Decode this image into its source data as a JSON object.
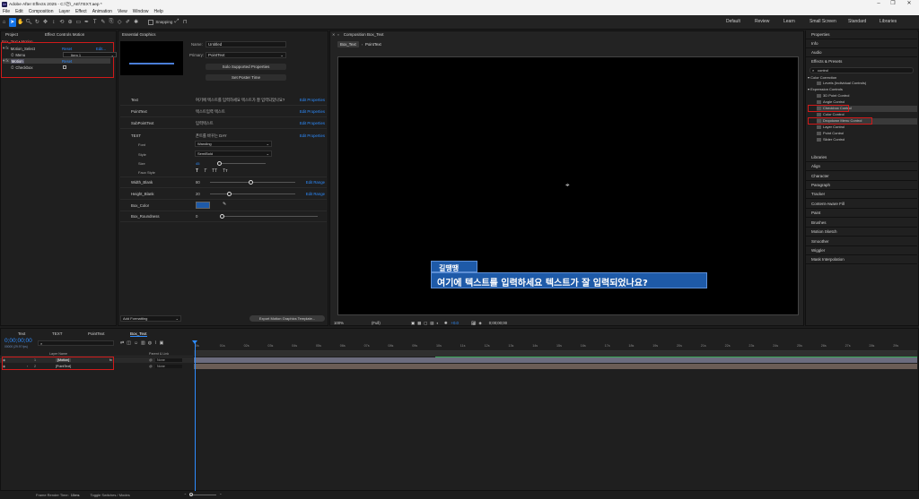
{
  "window": {
    "title": "Adobe After Effects 2025 - C:\\전\\_AE\\TEXT.aep *"
  },
  "menu": [
    "File",
    "Edit",
    "Composition",
    "Layer",
    "Effect",
    "Animation",
    "View",
    "Window",
    "Help"
  ],
  "toolbar": {
    "snapping_label": "Snapping"
  },
  "workspaces": [
    "Default",
    "Review",
    "Learn",
    "Small Screen",
    "Standard",
    "Libraries"
  ],
  "project_panel": {
    "tabs": [
      "Project",
      "Effect Controls Motion"
    ],
    "title": "Box_Text • Motion",
    "effects": [
      {
        "name": "Motion_Select",
        "reset": "Reset",
        "extra": "Edit..."
      },
      {
        "name": "Menu",
        "value": "Item 1"
      },
      {
        "name": "Motion",
        "reset": "Reset"
      },
      {
        "name": "Checkbox"
      }
    ]
  },
  "essential_graphics": {
    "tab": "Essential Graphics",
    "name_label": "Name:",
    "name_value": "Untitled",
    "primary_label": "Primary:",
    "primary_value": "PointText",
    "solo_button": "Solo Supported Properties",
    "poster_button": "Set Poster Time",
    "rows": [
      {
        "label": "Text",
        "value": "여기에 텍스트를 입력하세요 텍스트가 잘 입력되었나요?",
        "edit": "Edit Properties"
      },
      {
        "label": "PointText",
        "value": "텍스트입력 텍스트",
        "edit": "Edit Properties"
      },
      {
        "label": "SubPointText",
        "value": "입력텍스트",
        "edit": "Edit Properties"
      },
      {
        "label": "TEXT",
        "value": "폰트를 바꾸는 DAY",
        "edit": "Edit Properties"
      }
    ],
    "font_label": "Font",
    "font_value": "Wanding",
    "style_label": "Style",
    "style_value": "SemiBold",
    "size_label": "Size",
    "size_value": "45",
    "faux_label": "Faux Style",
    "faux": [
      "T",
      "T",
      "TT",
      "Tт"
    ],
    "width_label": "Width_Blank",
    "width_value": "80",
    "width_edit": "Edit Range",
    "height_label": "Height_Blank",
    "height_value": "20",
    "height_edit": "Edit Range",
    "color_label": "Box_Color",
    "color_value": "#1e5aa8",
    "round_label": "Box_Roundness",
    "round_value": "0",
    "add_formatting": "Add Formatting",
    "export_button": "Export Motion Graphics Template..."
  },
  "composition": {
    "tab": "Composition Box_Text",
    "flow_tabs": [
      "Box_Text",
      "PointText"
    ],
    "name_box_text": "길땡땡",
    "subtitle_text": "여기에 텍스트를 입력하세요 텍스트가 잘 입력되었나요?",
    "zoom": "100%",
    "resolution": "(Full)",
    "exposure": "+0.0",
    "timecode": "0;00;00;00"
  },
  "right_panel": {
    "top_items": [
      "Properties",
      "Info",
      "Audio"
    ],
    "effects_title": "Effects & Presets",
    "search_value": "control",
    "category_color": "Color Correction",
    "color_items": [
      "Levels (Individual Controls)"
    ],
    "category_expression": "Expression Controls",
    "expression_items": [
      "3D Point Control",
      "Angle Control",
      "Checkbox Control",
      "Color Control",
      "Dropdown Menu Control",
      "Layer Control",
      "Point Control",
      "Slider Control"
    ],
    "lower_items": [
      "Libraries",
      "Align",
      "Character",
      "Paragraph",
      "Tracker",
      "Content-Aware Fill",
      "Paint",
      "Brushes",
      "Motion Sketch",
      "Smoother",
      "Wiggler",
      "Mask Interpolation"
    ]
  },
  "timeline": {
    "tabs": [
      "Text",
      "TEXT",
      "PointText",
      "Box_Text"
    ],
    "timecode": "0;00;00;00",
    "timecode_sub": "00000 (29.97 fps)",
    "header": {
      "layer_name": "Layer Name",
      "parent": "Parent & Link"
    },
    "layers": [
      {
        "num": "1",
        "name": "[Motion]",
        "parent": "None"
      },
      {
        "num": "2",
        "name": "[PointText]",
        "parent": "None"
      }
    ],
    "ruler": [
      "0s",
      "01s",
      "02s",
      "03s",
      "04s",
      "05s",
      "06s",
      "07s",
      "08s",
      "09s",
      "10s",
      "11s",
      "12s",
      "13s",
      "14s",
      "15s",
      "16s",
      "17s",
      "18s",
      "19s",
      "20s",
      "21s",
      "22s",
      "23s",
      "24s",
      "25s",
      "26s",
      "27s",
      "28s",
      "29s"
    ],
    "footer_render": "Frame Render Time:",
    "footer_render_value": "10ms",
    "footer_toggle": "Toggle Switches / Modes"
  }
}
